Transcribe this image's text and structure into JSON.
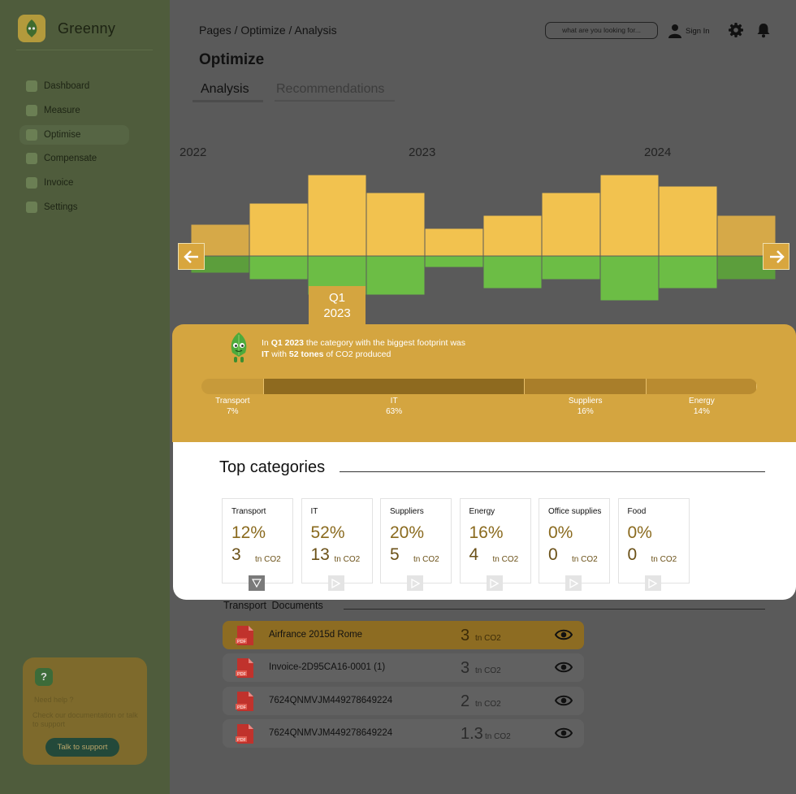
{
  "app": {
    "name": "Greenny"
  },
  "sidebar": {
    "items": [
      {
        "label": "Dashboard",
        "icon": "home-icon"
      },
      {
        "label": "Measure",
        "icon": "chart-icon"
      },
      {
        "label": "Optimise",
        "icon": "leaf-icon",
        "active": true
      },
      {
        "label": "Compensate",
        "icon": "grid-icon"
      },
      {
        "label": "Invoice",
        "icon": "document-icon"
      },
      {
        "label": "Settings",
        "icon": "gear-icon"
      }
    ],
    "help": {
      "icon": "?",
      "title": "Need help ?",
      "text": "Check our documentation or talk to support",
      "button": "Talk to support"
    }
  },
  "header": {
    "breadcrumb": "Pages / Optimize / Analysis",
    "search_placeholder": "what are you looking for...",
    "signin": "Sign In",
    "title": "Optimize",
    "tabs": [
      "Analysis",
      "Recommendations"
    ]
  },
  "chart_data": {
    "type": "bar",
    "x_labels": [
      "2022",
      "2023",
      "2024"
    ],
    "selected_label": "Q1\n2023",
    "bars_up": [
      39,
      65,
      100,
      78,
      34,
      50,
      78,
      100,
      86,
      50
    ],
    "bars_down": [
      21,
      29,
      48,
      48,
      14,
      40,
      29,
      55,
      40,
      29
    ],
    "selected_index": 2,
    "dimmed_indices": [
      0,
      9
    ],
    "colors": {
      "up": "#f2c24f",
      "up_dim": "#d6a948",
      "down": "#6cbd45",
      "down_dim": "#5c9e3c"
    }
  },
  "insight": {
    "prefix": "In ",
    "period": "Q1 2023",
    "mid": " the category with the biggest footprint was ",
    "category": "IT",
    "with": " with ",
    "amount": "52 tones",
    "suffix": " of CO2 produced"
  },
  "split": [
    {
      "label": "Transport",
      "pct": "7%",
      "share": 12.6,
      "color": "#c79a3a"
    },
    {
      "label": "IT",
      "pct": "63%",
      "share": 52.8,
      "color": "#8e6a1f"
    },
    {
      "label": "Suppliers",
      "pct": "16%",
      "share": 24.7,
      "color": "#a97e2a"
    },
    {
      "label": "Energy",
      "pct": "14%",
      "share": 22.4,
      "color": "#b98b30"
    }
  ],
  "top_categories": {
    "title": "Top categories",
    "unit": "tn CO2",
    "cards": [
      {
        "name": "Transport",
        "pct": "12%",
        "value": "3",
        "active": true
      },
      {
        "name": "IT",
        "pct": "52%",
        "value": "13",
        "active": false
      },
      {
        "name": "Suppliers",
        "pct": "20%",
        "value": "5",
        "active": false
      },
      {
        "name": "Energy",
        "pct": "16%",
        "value": "4",
        "active": false
      },
      {
        "name": "Office supplies",
        "pct": "0%",
        "value": "0",
        "active": false
      },
      {
        "name": "Food",
        "pct": "0%",
        "value": "0",
        "active": false
      }
    ]
  },
  "documents": {
    "title": "Transport Documents",
    "unit": "tn CO2",
    "rows": [
      {
        "name": "Airfrance 2015d Rome",
        "value": "3",
        "highlight": true
      },
      {
        "name": "Invoice-2D95CA16-0001 (1)",
        "value": "3",
        "highlight": false
      },
      {
        "name": "7624QNMVJM449278649224",
        "value": "2",
        "highlight": false
      },
      {
        "name": "7624QNMVJM449278649224",
        "value": "1.3",
        "highlight": false
      }
    ]
  }
}
